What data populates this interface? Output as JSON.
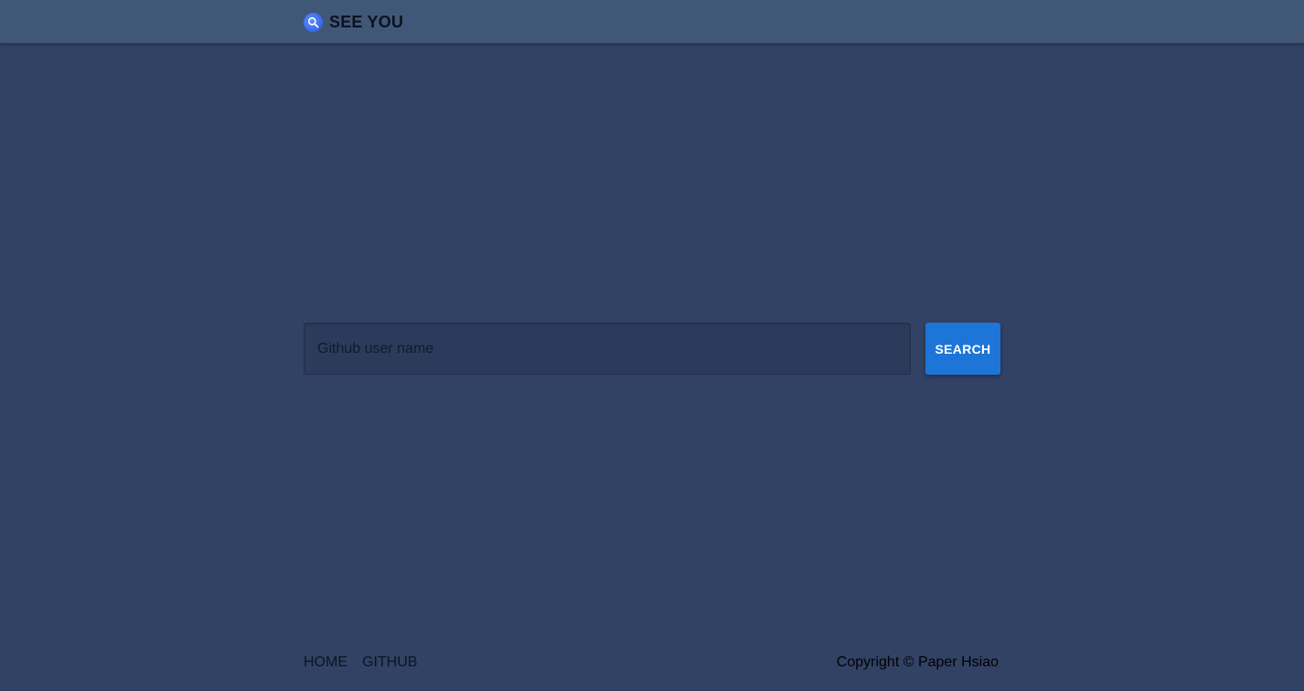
{
  "header": {
    "brand_title": "SEE YOU",
    "logo_icon": "search-icon"
  },
  "search": {
    "placeholder": "Github user name",
    "value": "",
    "button_label": "SEARCH"
  },
  "footer": {
    "links": [
      {
        "label": "HOME"
      },
      {
        "label": "GITHUB"
      }
    ],
    "copyright": "Copyright © Paper Hsiao"
  },
  "colors": {
    "background": "#324264",
    "header": "#405777",
    "accent": "#1d75d8"
  }
}
